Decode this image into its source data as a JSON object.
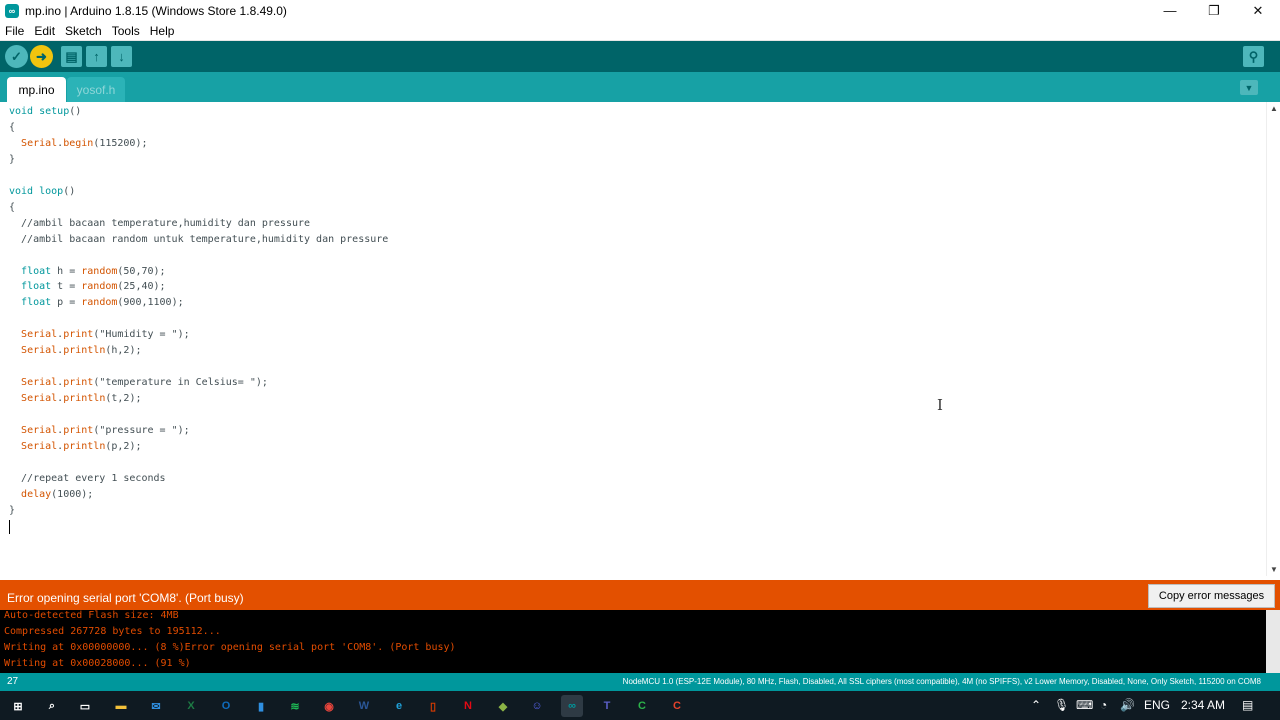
{
  "window": {
    "title": "mp.ino | Arduino 1.8.15 (Windows Store 1.8.49.0)",
    "app_icon": "arduino-icon",
    "controls": [
      "minimize-icon",
      "maximize-icon",
      "close-icon"
    ]
  },
  "menu": {
    "items": [
      "File",
      "Edit",
      "Sketch",
      "Tools",
      "Help"
    ]
  },
  "toolbar": {
    "buttons": [
      "verify-icon",
      "upload-icon",
      "new-icon",
      "open-icon",
      "save-icon",
      "serial-monitor-icon"
    ]
  },
  "tabs": [
    {
      "label": "mp.ino",
      "active": true
    },
    {
      "label": "yosof.h",
      "active": false
    }
  ],
  "editor": {
    "lines": [
      [
        {
          "t": "void",
          "c": "kw"
        },
        {
          "t": " "
        },
        {
          "t": "setup",
          "c": "kw"
        },
        {
          "t": "()"
        }
      ],
      [
        {
          "t": "{"
        }
      ],
      [
        {
          "t": "  "
        },
        {
          "t": "Serial",
          "c": "fn"
        },
        {
          "t": "."
        },
        {
          "t": "begin",
          "c": "fn"
        },
        {
          "t": "(115200);"
        }
      ],
      [
        {
          "t": "}"
        }
      ],
      [
        {
          "t": ""
        }
      ],
      [
        {
          "t": "void",
          "c": "kw"
        },
        {
          "t": " "
        },
        {
          "t": "loop",
          "c": "kw"
        },
        {
          "t": "()"
        }
      ],
      [
        {
          "t": "{"
        }
      ],
      [
        {
          "t": "  //ambil bacaan temperature,humidity dan pressure",
          "c": "cm"
        }
      ],
      [
        {
          "t": "  //ambil bacaan random untuk temperature,humidity dan pressure",
          "c": "cm"
        }
      ],
      [
        {
          "t": ""
        }
      ],
      [
        {
          "t": "  "
        },
        {
          "t": "float",
          "c": "kw"
        },
        {
          "t": " h = "
        },
        {
          "t": "random",
          "c": "fn"
        },
        {
          "t": "(50,70);"
        }
      ],
      [
        {
          "t": "  "
        },
        {
          "t": "float",
          "c": "kw"
        },
        {
          "t": " t = "
        },
        {
          "t": "random",
          "c": "fn"
        },
        {
          "t": "(25,40);"
        }
      ],
      [
        {
          "t": "  "
        },
        {
          "t": "float",
          "c": "kw"
        },
        {
          "t": " p = "
        },
        {
          "t": "random",
          "c": "fn"
        },
        {
          "t": "(900,1100);"
        }
      ],
      [
        {
          "t": ""
        }
      ],
      [
        {
          "t": "  "
        },
        {
          "t": "Serial",
          "c": "fn"
        },
        {
          "t": "."
        },
        {
          "t": "print",
          "c": "fn"
        },
        {
          "t": "(\"Humidity = \");"
        }
      ],
      [
        {
          "t": "  "
        },
        {
          "t": "Serial",
          "c": "fn"
        },
        {
          "t": "."
        },
        {
          "t": "println",
          "c": "fn"
        },
        {
          "t": "(h,2);"
        }
      ],
      [
        {
          "t": ""
        }
      ],
      [
        {
          "t": "  "
        },
        {
          "t": "Serial",
          "c": "fn"
        },
        {
          "t": "."
        },
        {
          "t": "print",
          "c": "fn"
        },
        {
          "t": "(\"temperature in Celsius= \");"
        }
      ],
      [
        {
          "t": "  "
        },
        {
          "t": "Serial",
          "c": "fn"
        },
        {
          "t": "."
        },
        {
          "t": "println",
          "c": "fn"
        },
        {
          "t": "(t,2);"
        }
      ],
      [
        {
          "t": ""
        }
      ],
      [
        {
          "t": "  "
        },
        {
          "t": "Serial",
          "c": "fn"
        },
        {
          "t": "."
        },
        {
          "t": "print",
          "c": "fn"
        },
        {
          "t": "(\"pressure = \");"
        }
      ],
      [
        {
          "t": "  "
        },
        {
          "t": "Serial",
          "c": "fn"
        },
        {
          "t": "."
        },
        {
          "t": "println",
          "c": "fn"
        },
        {
          "t": "(p,2);"
        }
      ],
      [
        {
          "t": ""
        }
      ],
      [
        {
          "t": "  //repeat every 1 seconds",
          "c": "cm"
        }
      ],
      [
        {
          "t": "  "
        },
        {
          "t": "delay",
          "c": "fn"
        },
        {
          "t": "(1000);"
        }
      ],
      [
        {
          "t": "}"
        }
      ]
    ]
  },
  "status": {
    "message": "Error opening serial port 'COM8'. (Port busy)",
    "copy_button": "Copy error messages"
  },
  "console": {
    "lines": [
      "Auto-detected Flash size: 4MB",
      "Compressed 267728 bytes to 195112...",
      "Writing at 0x00000000... (8 %)Error opening serial port 'COM8'. (Port busy)",
      "Writing at 0x00028000... (91 %)"
    ]
  },
  "footer": {
    "line_number": "27",
    "board": "NodeMCU 1.0 (ESP-12E Module), 80 MHz, Flash, Disabled, All SSL ciphers (most compatible), 4M (no SPIFFS), v2 Lower Memory, Disabled, None, Only Sketch, 115200 on COM8"
  },
  "taskbar": {
    "apps": [
      {
        "name": "windows-start-icon",
        "glyph": "⊞",
        "color": "#ffffff"
      },
      {
        "name": "search-icon",
        "glyph": "⌕",
        "color": "#ffffff"
      },
      {
        "name": "task-view-icon",
        "glyph": "▭",
        "color": "#ffffff"
      },
      {
        "name": "file-explorer-icon",
        "glyph": "▬",
        "color": "#f3c13a"
      },
      {
        "name": "mail-icon",
        "glyph": "✉",
        "color": "#2f8fe0"
      },
      {
        "name": "excel-icon",
        "glyph": "X",
        "color": "#1d7a44"
      },
      {
        "name": "outlook-icon",
        "glyph": "O",
        "color": "#0f6cbd"
      },
      {
        "name": "store-icon",
        "glyph": "▮",
        "color": "#2f8fe0"
      },
      {
        "name": "spotify-icon",
        "glyph": "≋",
        "color": "#1db954"
      },
      {
        "name": "chrome-icon",
        "glyph": "◉",
        "color": "#e8453c"
      },
      {
        "name": "word-icon",
        "glyph": "W",
        "color": "#2b5797"
      },
      {
        "name": "edge-icon",
        "glyph": "e",
        "color": "#1fa0d8"
      },
      {
        "name": "office-icon",
        "glyph": "▯",
        "color": "#d83b01"
      },
      {
        "name": "netflix-icon",
        "glyph": "N",
        "color": "#e50914"
      },
      {
        "name": "minecraft-icon",
        "glyph": "◆",
        "color": "#8bb346"
      },
      {
        "name": "discord-icon",
        "glyph": "☺",
        "color": "#5865f2"
      },
      {
        "name": "arduino-icon",
        "glyph": "∞",
        "color": "#00979c"
      },
      {
        "name": "teams-icon",
        "glyph": "T",
        "color": "#5b5fc7"
      },
      {
        "name": "camtasia-icon",
        "glyph": "C",
        "color": "#2cb34a"
      },
      {
        "name": "recorder-icon",
        "glyph": "C",
        "color": "#e5432c"
      }
    ],
    "tray": {
      "icons": [
        "chevron-up-icon",
        "microphone-icon",
        "keyboard-icon",
        "wifi-icon",
        "volume-icon"
      ],
      "language": "ENG",
      "time": "2:34 AM",
      "notification_icon": "notification-icon"
    }
  }
}
